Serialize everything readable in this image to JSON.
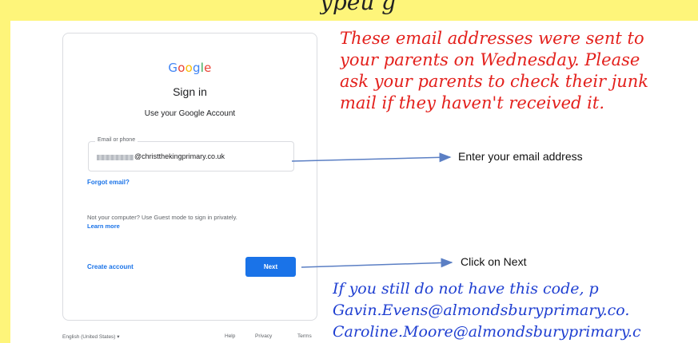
{
  "heading_fragment": "ypeu g",
  "google_logo": [
    "G",
    "o",
    "o",
    "g",
    "l",
    "e"
  ],
  "signin": {
    "title": "Sign in",
    "subtitle": "Use your Google Account",
    "email_label": "Email or phone",
    "email_value": "@christthekingprimary.co.uk",
    "forgot_email": "Forgot email?",
    "guest_text": "Not your computer? Use Guest mode to sign in privately.",
    "learn_more": "Learn more",
    "create_account": "Create account",
    "next": "Next"
  },
  "footer": {
    "language": "English (United States)  ▾",
    "help": "Help",
    "privacy": "Privacy",
    "terms": "Terms"
  },
  "note_red": [
    "These email addresses were sent to",
    "your parents on Wednesday. Please",
    "ask your parents to check their junk",
    "mail if they haven't received it."
  ],
  "annotations": {
    "email": "Enter your email address",
    "next": "Click on Next"
  },
  "note_blue": [
    "If you still do not have this code, p",
    "Gavin.Evens@almondsburyprimary.co.",
    "Caroline.Moore@almondsburyprimary.c"
  ],
  "colors": {
    "frame": "#fef57a",
    "google_blue": "#1a73e8",
    "note_red": "#e3201c",
    "note_blue": "#1f3fd1",
    "arrow": "#5b7fc4"
  }
}
